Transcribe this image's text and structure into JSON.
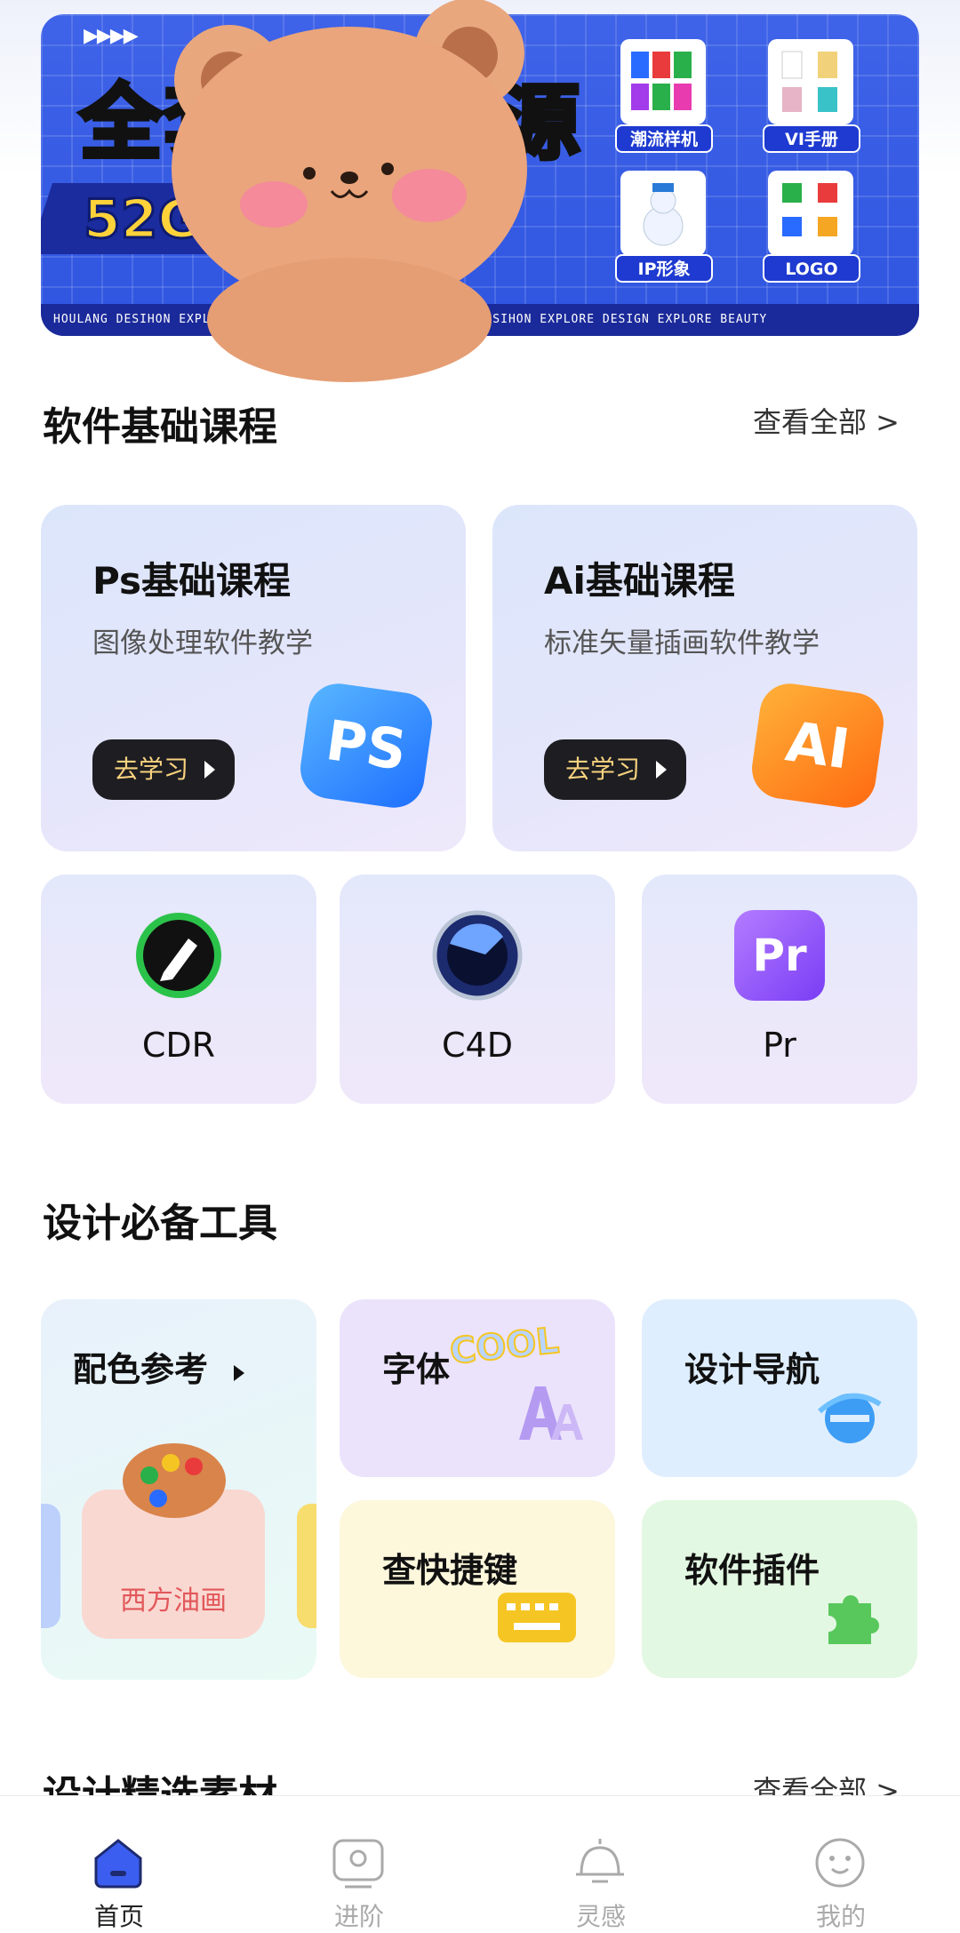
{
  "banner": {
    "title": "全套模版资源",
    "size_text": "52G",
    "arrows": "▶▶▶▶",
    "ticker": "HOULANG DESIHON EXPLORE DESIGN EXPLORE BEAUTY HOULANG DESIHON EXPLORE DESIGN EXPLORE BEAUTY",
    "tiles": [
      "潮流样机",
      "VI手册",
      "IP形象",
      "LOGO"
    ]
  },
  "software": {
    "title": "软件基础课程",
    "more": "查看全部 >",
    "cards": [
      {
        "title": "Ps基础课程",
        "subtitle": "图像处理软件教学",
        "button": "去学习",
        "icon": "ps-icon",
        "icon_text": "PS"
      },
      {
        "title": "Ai基础课程",
        "subtitle": "标准矢量插画软件教学",
        "button": "去学习",
        "icon": "ai-icon",
        "icon_text": "AI"
      }
    ],
    "small": [
      {
        "label": "CDR",
        "icon": "coreldraw-icon"
      },
      {
        "label": "C4D",
        "icon": "cinema4d-icon"
      },
      {
        "label": "Pr",
        "icon": "premiere-icon",
        "icon_text": "Pr"
      }
    ]
  },
  "tools": {
    "title": "设计必备工具",
    "items": [
      {
        "title": "配色参考",
        "sub": "西方油画",
        "icon": "palette-icon"
      },
      {
        "title": "字体",
        "deco": "COOL",
        "icon": "font-icon"
      },
      {
        "title": "设计导航",
        "icon": "browser-icon"
      },
      {
        "title": "查快捷键",
        "icon": "keyboard-icon"
      },
      {
        "title": "软件插件",
        "icon": "puzzle-icon"
      }
    ]
  },
  "materials": {
    "title": "设计精选素材",
    "more": "查看全部 >"
  },
  "nav": [
    {
      "label": "首页",
      "icon": "home-icon",
      "active": true
    },
    {
      "label": "进阶",
      "icon": "advance-icon",
      "active": false
    },
    {
      "label": "灵感",
      "icon": "bell-icon",
      "active": false
    },
    {
      "label": "我的",
      "icon": "profile-icon",
      "active": false
    }
  ],
  "colors": {
    "banner_blue": "#3159e3",
    "ps_blue": "#1e7dff",
    "ai_orange": "#ff7a1a",
    "pr_purple": "#8a4dff",
    "nav_active": "#3b5ef0"
  }
}
